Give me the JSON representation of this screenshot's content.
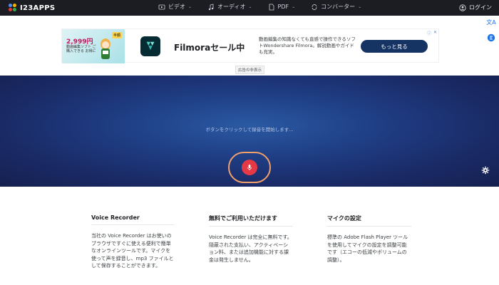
{
  "header": {
    "logo_text": "I23APPS",
    "nav": [
      {
        "label": "ビデオ",
        "icon": "video-icon"
      },
      {
        "label": "オーディオ",
        "icon": "music-note-icon"
      },
      {
        "label": "PDF",
        "icon": "document-icon"
      },
      {
        "label": "コンバーター",
        "icon": "convert-icon"
      }
    ],
    "login_label": "ログイン"
  },
  "ad": {
    "image_price": "2,999円",
    "image_badge": "半額",
    "image_subtitle": "動画編集ソフト ご購入できる お得に",
    "title": "Filmoraセール中",
    "description": "動画編集の知識なくても直感で操作できるソフトWondershare Filmora。解説動画やガイドも充実。",
    "cta": "もっと見る",
    "hide_label": "広告の非表示"
  },
  "recorder": {
    "hint": "ボタンをクリックして録音を開始します..."
  },
  "info": [
    {
      "title": "Voice Recorder",
      "body": "当社の Voice Recorder はお使いのブラウザですぐに使える便利で簡単なオンラインツールです。マイクを使って声を録音し、mp3 ファイルとして保存することができます。"
    },
    {
      "title": "無料でご利用いただけます",
      "body": "Voice Recorder は完全に無料です。隠蔽された支払い、アクティベーション料、または追加機能に対する課金は発生しません。"
    },
    {
      "title": "マイクの設定",
      "body": "標準の Adobe Flash Player ツールを使用してマイクの設定を調整可能です（エコーの低減やボリュームの調整）。"
    }
  ],
  "colors": {
    "topbar": "#1b1d22",
    "stage": "#1f3f86",
    "mic": "#e53946",
    "mic_ring": "#f2a06a",
    "ad_cta": "#153463"
  }
}
